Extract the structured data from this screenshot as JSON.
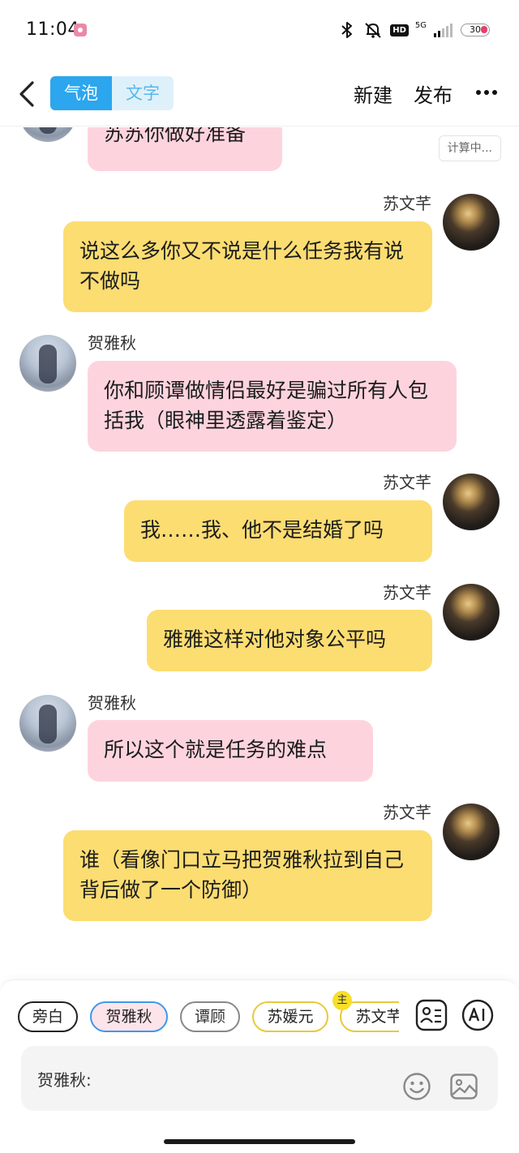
{
  "status_bar": {
    "time": "11:04",
    "hd": "HD",
    "network": "5G",
    "battery": "30"
  },
  "header": {
    "tabs": [
      {
        "label": "气泡",
        "active": true
      },
      {
        "label": "文字",
        "active": false
      }
    ],
    "new_label": "新建",
    "publish_label": "发布"
  },
  "computing_tag": "计算中...",
  "messages": [
    {
      "side": "left",
      "speaker": "",
      "text": "苏苏你做好准备"
    },
    {
      "side": "right",
      "speaker": "苏文芊",
      "text": "说这么多你又不说是什么任务我有说不做吗"
    },
    {
      "side": "left",
      "speaker": "贺雅秋",
      "text": "你和顾谭做情侣最好是骗过所有人包括我（眼神里透露着鉴定）"
    },
    {
      "side": "right",
      "speaker": "苏文芊",
      "text": "我……我、他不是结婚了吗"
    },
    {
      "side": "right",
      "speaker": "苏文芊",
      "text": "雅雅这样对他对象公平吗"
    },
    {
      "side": "left",
      "speaker": "贺雅秋",
      "text": "所以这个就是任务的难点"
    },
    {
      "side": "right",
      "speaker": "苏文芊",
      "text": "谁（看像门口立马把贺雅秋拉到自己背后做了一个防御）"
    }
  ],
  "characters": [
    {
      "label": "旁白"
    },
    {
      "label": "贺雅秋",
      "selected": true
    },
    {
      "label": "谭顾"
    },
    {
      "label": "苏媛元"
    },
    {
      "label": "苏文芊",
      "host": true
    }
  ],
  "host_badge": "主",
  "input": {
    "label": "贺雅秋:"
  },
  "colors": {
    "accent_blue": "#2ca6ee",
    "bubble_pink": "#fdd4de",
    "bubble_yellow": "#fcdd72"
  }
}
